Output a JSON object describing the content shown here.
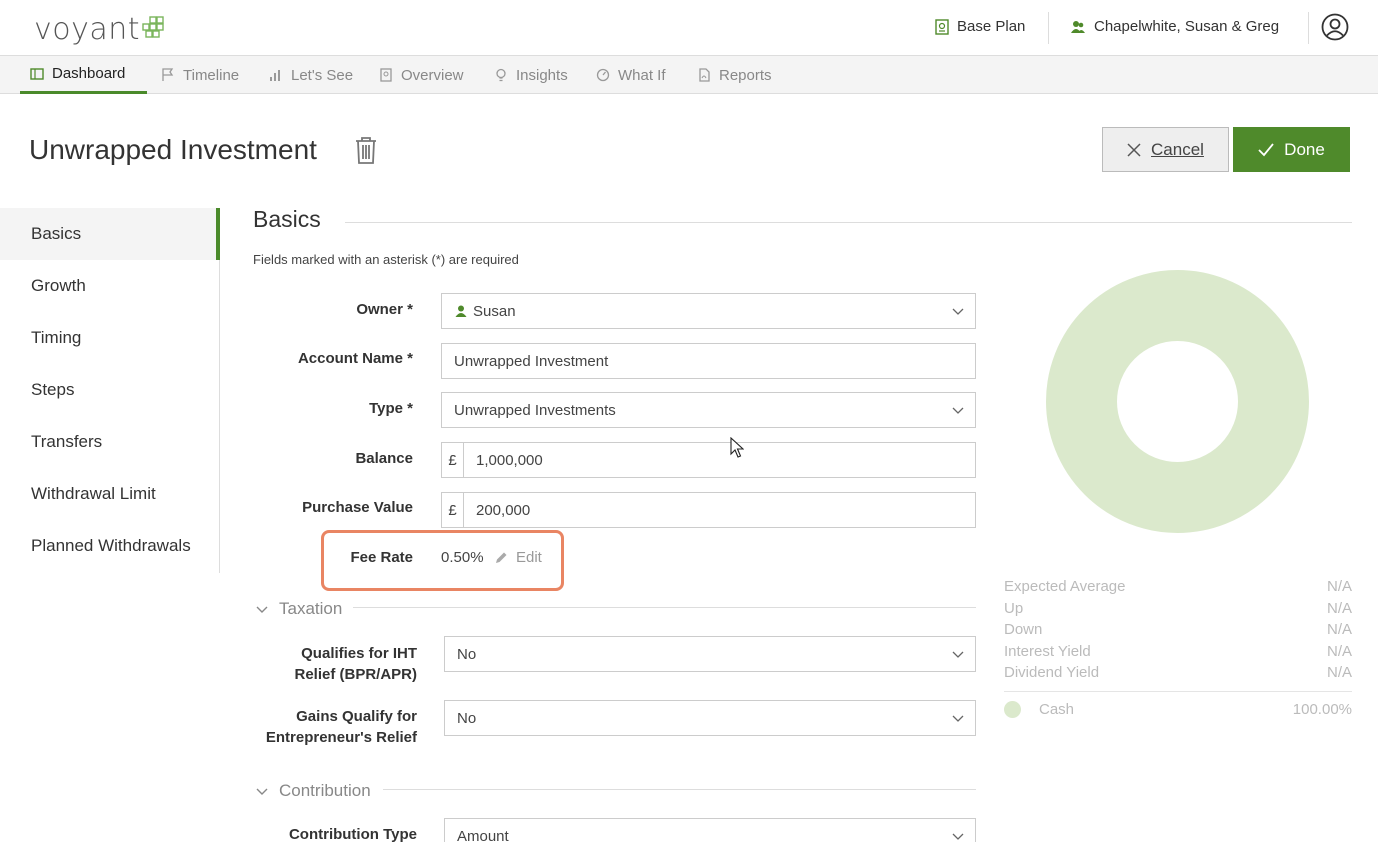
{
  "header": {
    "logo": "voyant",
    "plan": "Base Plan",
    "client": "Chapelwhite, Susan & Greg"
  },
  "tabs": [
    {
      "label": "Dashboard",
      "icon": "dashboard-icon",
      "active": true
    },
    {
      "label": "Timeline",
      "icon": "flag-icon"
    },
    {
      "label": "Let's See",
      "icon": "bar-chart-icon"
    },
    {
      "label": "Overview",
      "icon": "document-icon"
    },
    {
      "label": "Insights",
      "icon": "lightbulb-icon"
    },
    {
      "label": "What If",
      "icon": "gauge-icon"
    },
    {
      "label": "Reports",
      "icon": "pdf-icon"
    }
  ],
  "page": {
    "title": "Unwrapped Investment",
    "cancel_label": "Cancel",
    "done_label": "Done"
  },
  "sidenav": [
    "Basics",
    "Growth",
    "Timing",
    "Steps",
    "Transfers",
    "Withdrawal Limit",
    "Planned Withdrawals"
  ],
  "basics": {
    "heading": "Basics",
    "hint": "Fields marked with an asterisk (*) are required",
    "owner_label": "Owner *",
    "owner_value": "Susan",
    "account_name_label": "Account Name *",
    "account_name_value": "Unwrapped Investment",
    "type_label": "Type *",
    "type_value": "Unwrapped Investments",
    "balance_label": "Balance",
    "currency": "£",
    "balance_value": "1,000,000",
    "purchase_label": "Purchase Value",
    "purchase_value": "200,000",
    "fee_label": "Fee Rate",
    "fee_value": "0.50%",
    "fee_edit": "Edit"
  },
  "taxation": {
    "heading": "Taxation",
    "iht_label_1": "Qualifies for IHT",
    "iht_label_2": "Relief (BPR/APR)",
    "iht_value": "No",
    "gains_label_1": "Gains Qualify for",
    "gains_label_2": "Entrepreneur's Relief",
    "gains_value": "No"
  },
  "contribution": {
    "heading": "Contribution",
    "type_label": "Contribution Type",
    "type_value": "Amount"
  },
  "stats": [
    {
      "label": "Expected Average",
      "value": "N/A"
    },
    {
      "label": "Up",
      "value": "N/A"
    },
    {
      "label": "Down",
      "value": "N/A"
    },
    {
      "label": "Interest Yield",
      "value": "N/A"
    },
    {
      "label": "Dividend Yield",
      "value": "N/A"
    }
  ],
  "legend": {
    "label": "Cash",
    "value": "100.00%"
  },
  "colors": {
    "brand": "#4f8a2b",
    "highlight": "#e98563",
    "donut": "#dbe9cc"
  }
}
